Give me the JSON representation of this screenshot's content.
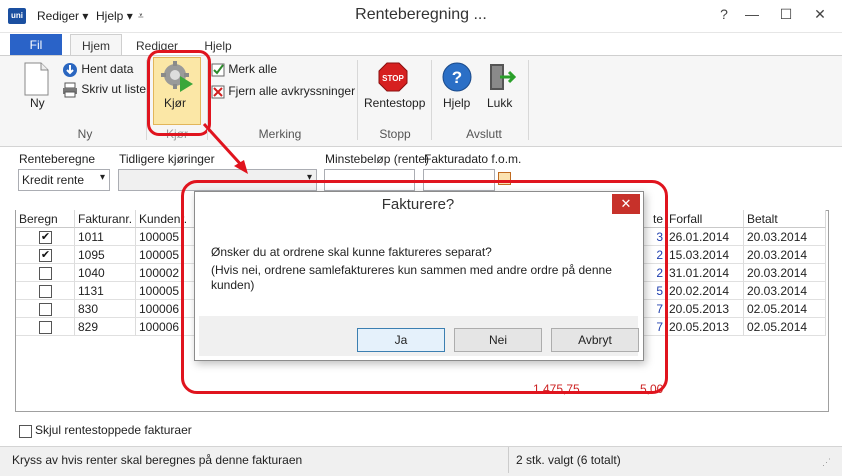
{
  "app": {
    "logo_text": "uni",
    "window_title": "Renteberegning ..."
  },
  "quick_access": {
    "rediger": "Rediger",
    "hjelp": "Hjelp"
  },
  "window_controls": {
    "help": "?",
    "minimize": "—",
    "maximize": "☐",
    "close": "✕"
  },
  "tabs": {
    "fil": "Fil",
    "hjem": "Hjem",
    "rediger": "Rediger",
    "hjelp": "Hjelp"
  },
  "ribbon": {
    "ny": "Ny",
    "hent_data": "Hent data",
    "skriv_ut_liste": "Skriv ut liste",
    "kjor": "Kjør",
    "merk_alle": "Merk alle",
    "fjern_alle": "Fjern alle avkryssninger",
    "rentestopp": "Rentestopp",
    "hjelp": "Hjelp",
    "lukk": "Lukk",
    "groups": {
      "ny": "Ny",
      "kjor": "Kjør",
      "merking": "Merking",
      "stopp": "Stopp",
      "avslutt": "Avslutt"
    }
  },
  "filters": {
    "renteberegne_label": "Renteberegne",
    "renteberegne_value": "Kredit rente",
    "tidligere_label": "Tidligere kjøringer",
    "tidligere_value": "",
    "minstebelop_label": "Minstebeløp (rente)",
    "minstebelop_value": "",
    "fakturadato_label": "Fakturadato f.o.m.",
    "fakturadato_value": ""
  },
  "grid": {
    "columns": [
      "Beregn",
      "Fakturanr.",
      "Kundenr.",
      "te",
      "Forfall",
      "Betalt"
    ],
    "rows": [
      {
        "checked": "✔",
        "fakturanr": "1011",
        "kundenr": "100005",
        "dager": "3",
        "forfall": "26.01.2014",
        "betalt": "20.03.2014"
      },
      {
        "checked": "✔",
        "fakturanr": "1095",
        "kundenr": "100005",
        "dager": "2",
        "forfall": "15.03.2014",
        "betalt": "20.03.2014"
      },
      {
        "checked": "",
        "fakturanr": "1040",
        "kundenr": "100002",
        "dager": "2",
        "forfall": "31.01.2014",
        "betalt": "20.03.2014"
      },
      {
        "checked": "",
        "fakturanr": "1131",
        "kundenr": "100005",
        "dager": "5",
        "forfall": "20.02.2014",
        "betalt": "20.03.2014"
      },
      {
        "checked": "",
        "fakturanr": "830",
        "kundenr": "100006",
        "dager": "7",
        "forfall": "20.05.2013",
        "betalt": "02.05.2014"
      },
      {
        "checked": "",
        "fakturanr": "829",
        "kundenr": "100006",
        "dager": "7",
        "forfall": "20.05.2013",
        "betalt": "02.05.2014"
      }
    ],
    "total_amount": "1 475,75",
    "total_dager": "5,00"
  },
  "dialog": {
    "title": "Fakturere?",
    "close": "✕",
    "message": "Ønsker du at ordrene skal kunne faktureres separat?",
    "detail": "(Hvis nei, ordrene samlefaktureres kun sammen med andre ordre på denne kunden)",
    "ja": "Ja",
    "nei": "Nei",
    "avbryt": "Avbryt"
  },
  "skjul": {
    "label": "Skjul rentestoppede fakturaer"
  },
  "status": {
    "left": "Kryss av hvis renter skal beregnes på denne fakturaen",
    "right": "2 stk. valgt (6 totalt)"
  },
  "colors": {
    "accent": "#2a63c8",
    "annotation": "#e0141e",
    "close_red": "#c7312a"
  }
}
